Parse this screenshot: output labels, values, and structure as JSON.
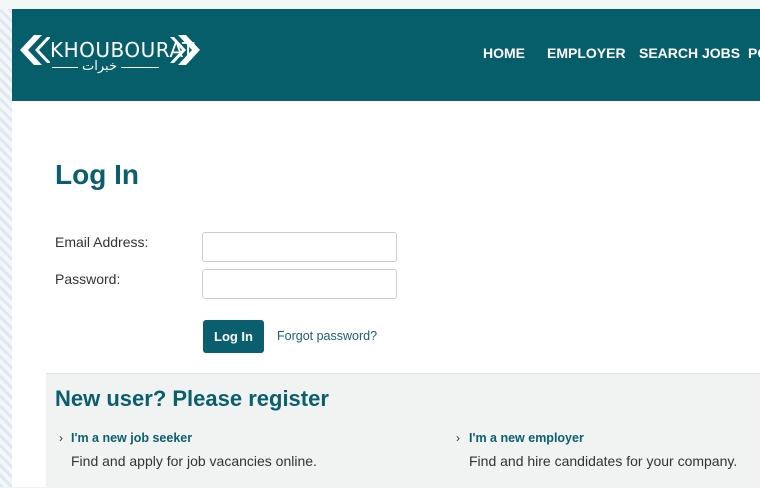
{
  "brand": {
    "name": "KHOUBOURAT",
    "arabic": "خبرات",
    "color_header": "#075e6b",
    "color_primary": "#0a5f6e"
  },
  "nav": {
    "items": [
      "HOME",
      "EMPLOYER",
      "SEARCH JOBS",
      "PO"
    ]
  },
  "login": {
    "title": "Log In",
    "email_label": "Email Address:",
    "email_value": "",
    "password_label": "Password:",
    "password_value": "",
    "submit_label": "Log In",
    "forgot_label": "Forgot password?"
  },
  "register": {
    "title": "New user? Please register",
    "job_seeker": {
      "link": "I'm a new job seeker",
      "description": "Find and apply for job vacancies online."
    },
    "employer": {
      "link": "I'm a new employer",
      "description": "Find and hire candidates for your company."
    }
  },
  "icons": {
    "logo_left": "double-chevron-left-icon",
    "logo_right": "double-chevron-right-icon",
    "link_marker": "chevron-right-icon"
  }
}
